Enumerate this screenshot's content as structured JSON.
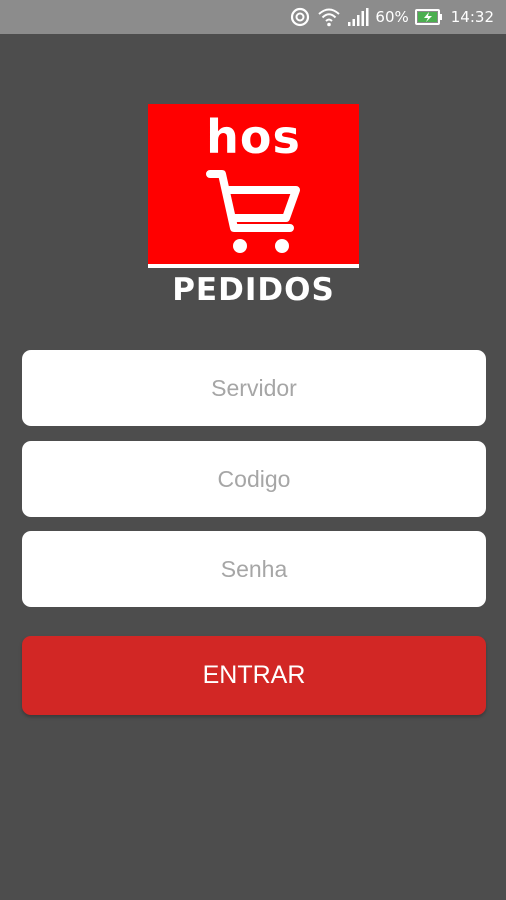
{
  "status_bar": {
    "battery_percent": "60%",
    "time": "14:32",
    "icons": [
      "sync-icon",
      "wifi-icon",
      "signal-icon",
      "battery-charging-icon"
    ]
  },
  "logo": {
    "brand_word": "hos",
    "caption": "PEDIDOS",
    "icon": "shopping-cart-icon"
  },
  "form": {
    "servidor_placeholder": "Servidor",
    "codigo_placeholder": "Codigo",
    "senha_placeholder": "Senha",
    "servidor_value": "",
    "codigo_value": "",
    "senha_value": ""
  },
  "login_button": {
    "label": "ENTRAR"
  },
  "colors": {
    "background": "#4d4d4d",
    "status_bar": "#8c8c8c",
    "logo_red": "#ff0000",
    "button_red": "#d22725",
    "battery_green": "#4caf50"
  }
}
